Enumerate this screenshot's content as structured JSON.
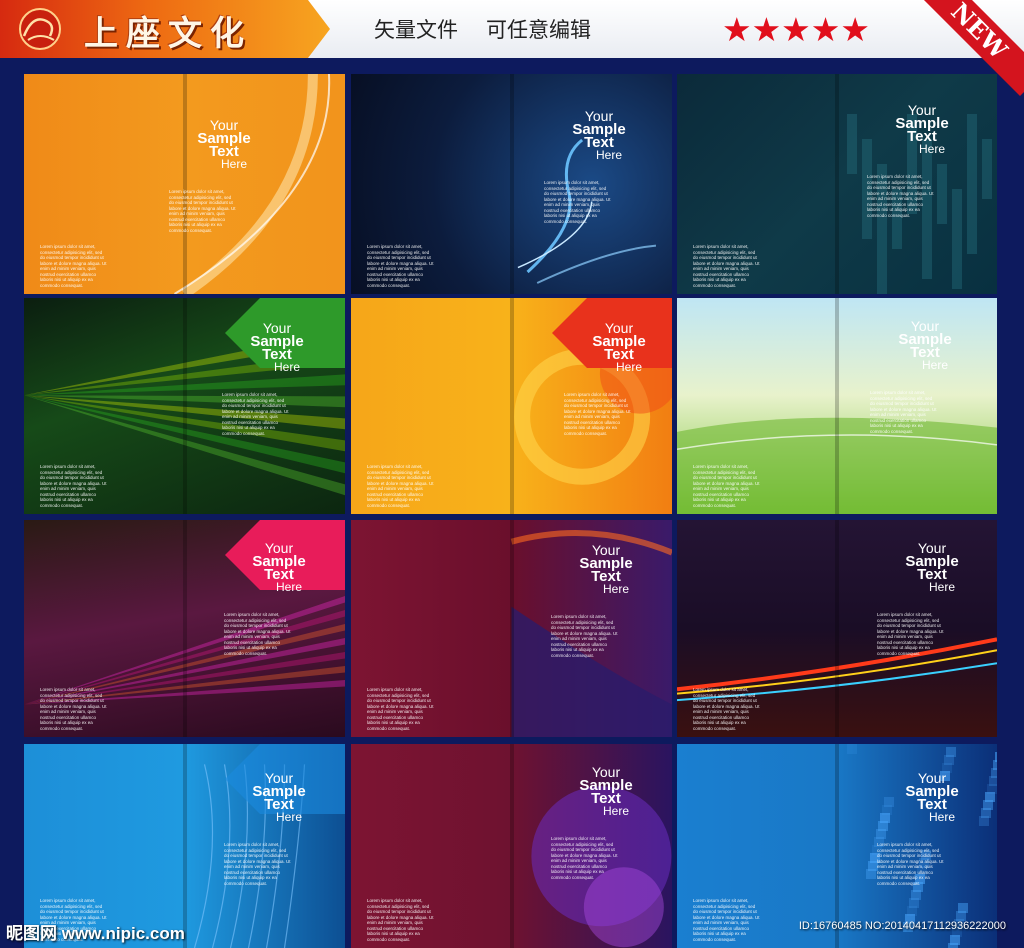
{
  "header": {
    "brand_name": "上座文化",
    "logo_text": "上座",
    "tagline_1": "矢量文件",
    "tagline_2": "可任意编辑",
    "stars": "★★★★★",
    "ribbon": "NEW"
  },
  "cover_text": {
    "line1": "Your",
    "line2": "Sample",
    "line3": "Text",
    "line4": "Here",
    "lorem": "Lorem ipsum dolor sit amet, consectetur adipisicing elit, sed do eiusmod tempor incididunt ut labore et dolore magna aliqua. Ut enim ad minim veniam, quis nostrud exercitation ullamco laboris nisi ut aliquip ex ea commodo consequat."
  },
  "covers": [
    {
      "name": "cover-orange-swoosh"
    },
    {
      "name": "cover-dark-blue-light-wave"
    },
    {
      "name": "cover-teal-blocks"
    },
    {
      "name": "cover-green-rays"
    },
    {
      "name": "cover-orange-circles"
    },
    {
      "name": "cover-sky-green-waves"
    },
    {
      "name": "cover-magenta-rays"
    },
    {
      "name": "cover-maroon-purple-curve"
    },
    {
      "name": "cover-dark-rainbow-wave"
    },
    {
      "name": "cover-blue-floral"
    },
    {
      "name": "cover-maroon-purple-glow"
    },
    {
      "name": "cover-blue-pixels"
    }
  ],
  "footer": {
    "watermark": "昵图网 www.nipic.com",
    "image_id": "ID:16760485 NO:20140417112936222000"
  },
  "colors": {
    "background": "#0d1a5e",
    "star_red": "#e10f1c",
    "brand_orange": "#ee6a12"
  }
}
